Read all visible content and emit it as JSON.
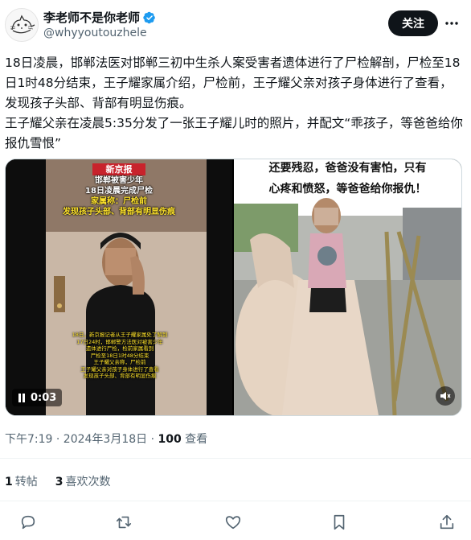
{
  "author": {
    "display_name": "李老师不是你老师",
    "handle": "@whyyoutouzhele",
    "verified": true,
    "avatar_icon": "cat-sketch-avatar-icon"
  },
  "header": {
    "follow_label": "关注",
    "more_icon": "more-horizontal-icon"
  },
  "tweet": {
    "text": "18日凌晨，邯郸法医对邯郸三初中生杀人案受害者遗体进行了尸检解剖，尸检至18日1时48分结束，王子耀家属介绍，尸检前，王子耀父亲对孩子身体进行了查看，发现孩子头部、背部有明显伤痕。\n王子耀父亲在凌晨5:35分发了一张王子耀儿时的照片，并配文“乖孩子，等爸爸给你报仇雪恨”"
  },
  "media": {
    "video": {
      "time": "0:03",
      "logo_text": "新京报",
      "caption_white": "邯郸被害少年\n18日凌晨完成尸检",
      "caption_yellow": "家属称：尸检前\n发现孩子头部、背部有明显伤痕",
      "subtitle_small": "18日，新京报记者从王子耀家属处了解到\n17日24时，邯郸警方法医对被害少年\n遗体进行尸检，检前家属看到\n尸检至18日1时48分结束\n王子耀父亲称，尸检前\n王子耀父亲对孩子身体进行了查看\n发现孩子头部、背部有明显伤痕"
    },
    "photo": {
      "caption_line1": "还要残忍，爸爸没有害怕，只有",
      "caption_line2": "心疼和愤怒，等爸爸给你报仇！"
    }
  },
  "meta": {
    "time": "下午7:19 · 2024年3月18日",
    "views_count": "100",
    "views_label": " 查看"
  },
  "stats": {
    "reposts_count": "1",
    "reposts_label": "转帖",
    "likes_count": "3",
    "likes_label": "喜欢次数"
  },
  "colors": {
    "accent_black": "#0f1419",
    "secondary_text": "#536471",
    "verified_blue": "#1d9bf0",
    "divider": "#eff3f4"
  },
  "action_icons": [
    "reply-icon",
    "repost-icon",
    "like-icon",
    "bookmark-icon",
    "share-icon"
  ]
}
